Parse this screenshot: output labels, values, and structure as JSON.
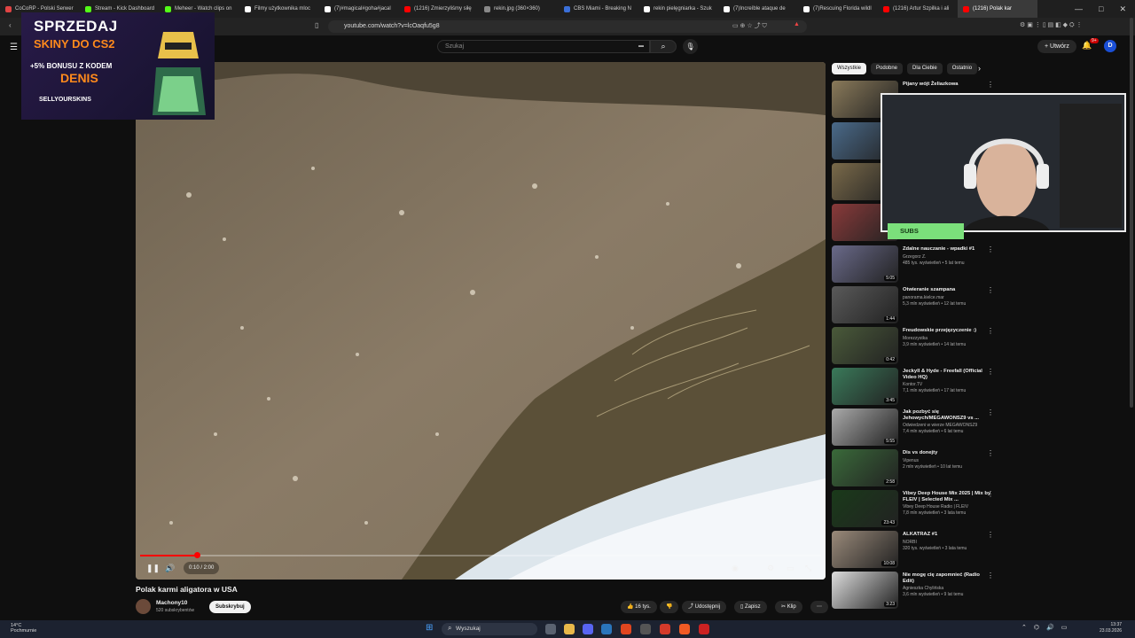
{
  "browser": {
    "tabs": [
      {
        "label": "CoCoRP - Polski Serwer",
        "color": "#e04444"
      },
      {
        "label": "Stream - Kick Dashboard",
        "color": "#53fc18"
      },
      {
        "label": "Meheer - Watch clips on",
        "color": "#53fc18"
      },
      {
        "label": "Filmy użytkownika mloc",
        "color": "#ffffff"
      },
      {
        "label": "(7)#magical#goha#jacal",
        "color": "#ffffff"
      },
      {
        "label": "(1216) Zmierzyliśmy siłę",
        "color": "#ff0000"
      },
      {
        "label": "rekin.jpg (360×360)",
        "color": "#888888"
      },
      {
        "label": "CBS Miami - Breaking N",
        "color": "#3a6fd8"
      },
      {
        "label": "rekin pielęgniarka - Szuk",
        "color": "#ffffff"
      },
      {
        "label": "(7)Increíble ataque de",
        "color": "#ffffff"
      },
      {
        "label": "(7)Rescuing Florida wildl",
        "color": "#ffffff"
      },
      {
        "label": "(1216) Artur Szpilka i ali",
        "color": "#ff0000"
      },
      {
        "label": "(1216) Polak kar",
        "color": "#ff0000",
        "active": true
      }
    ],
    "url": "youtube.com/watch?v=lcOaqfu5g8",
    "window_controls": [
      "—",
      "□",
      "✕"
    ]
  },
  "youtube": {
    "search_placeholder": "Szukaj",
    "create_label": "Utwórz",
    "notif_count": "9+",
    "avatar_letter": "D"
  },
  "ad": {
    "line1": "SPRZEDAJ",
    "line2": "SKINY DO CS2",
    "line3": "+5% BONUSU Z KODEM",
    "line4": "DENIS",
    "line5": "SELLYOURSKINS"
  },
  "player": {
    "time": "0:10 / 2:00",
    "progress": 0.083
  },
  "video": {
    "title": "Polak karmi aligatora w USA",
    "channel": "Machony10",
    "subscribers": "520 subskrybentów",
    "subscribe_label": "Subskrybuj",
    "likes": "16 tys.",
    "share_label": "Udostępnij",
    "save_label": "Zapisz",
    "clip_label": "Klip"
  },
  "chips": [
    "Wszystkie",
    "Podobne",
    "Dla Ciebie",
    "Ostatnio"
  ],
  "recommendations": [
    {
      "title": "Pijany wójt Żeliazkowa",
      "channel": "",
      "meta": "",
      "duration": ""
    },
    {
      "title": "",
      "channel": "",
      "meta": "",
      "duration": ""
    },
    {
      "title": "",
      "channel": "",
      "meta": "",
      "duration": ""
    },
    {
      "title": "",
      "channel": "",
      "meta": "",
      "duration": ""
    },
    {
      "title": "Zdalne nauczanie - wpadki #1",
      "channel": "Grzegorz Z.",
      "meta": "485 tys. wyświetleń • 5 lat temu",
      "duration": "5:05"
    },
    {
      "title": "Otwieranie szampana",
      "channel": "panorama.kielce.mar",
      "meta": "5,3 mln wyświetleń • 12 lat temu",
      "duration": "1:44"
    },
    {
      "title": "Freudowskie przejęzyczenie :)",
      "channel": "Morezzystka",
      "meta": "3,9 mln wyświetleń • 14 lat temu",
      "duration": "0:42"
    },
    {
      "title": "Jeckyll & Hyde - Freefall (Official Video HQ)",
      "channel": "Kontor.TV",
      "meta": "7,1 mln wyświetleń • 17 lat temu",
      "duration": "3:45"
    },
    {
      "title": "Jak pozbyć się Jehowych/MEGAWONSZ9 vs ...",
      "channel": "Odwiedzeni w wierze MEGAWONSZ9",
      "meta": "7,4 mln wyświetleń • 6 lat temu",
      "duration": "5:55"
    },
    {
      "title": "Dis vs donejty",
      "channel": "Vipenus",
      "meta": "2 mln wyświetleń • 10 lat temu",
      "duration": "2:58"
    },
    {
      "title": "Vibey Deep House Mix 2025 | Mix by FLEIV | Selected Mix ...",
      "channel": "Vibey Deep House Radio | FLEIV",
      "meta": "7,8 mln wyświetleń • 3 lata temu",
      "duration": "23:43"
    },
    {
      "title": "ALKATRAZ #1",
      "channel": "NORBI",
      "meta": "320 tys. wyświetleń • 3 lata temu",
      "duration": "10:08"
    },
    {
      "title": "Nie mogę cię zapomnieć (Radio Edit)",
      "channel": "Agnieszka Chylińska",
      "meta": "3,6 mln wyświetleń • 9 lat temu",
      "duration": "3:23"
    }
  ],
  "overlay": {
    "subs_label": "SUBS"
  },
  "taskbar": {
    "temp": "14°C",
    "weather": "Pochmurnie",
    "search": "Wyszukaj",
    "time": "13:37",
    "date": "23.03.2026"
  }
}
